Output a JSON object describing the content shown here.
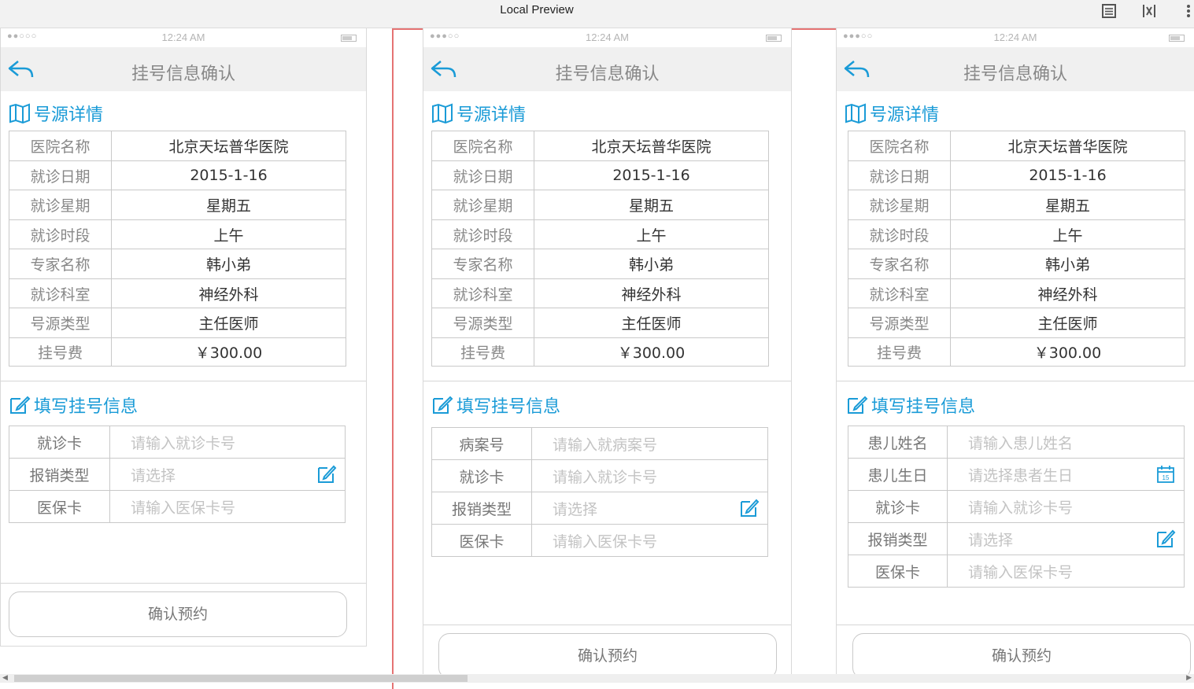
{
  "app": {
    "title": "Local Preview",
    "toolbar_icons": [
      "document-icon",
      "variable-icon",
      "more-icon"
    ]
  },
  "phone": {
    "status_time": "12:24 AM",
    "nav_title": "挂号信息确认",
    "section_detail_title": "号源详情",
    "section_form_title": "填写挂号信息",
    "confirm_label": "确认预约"
  },
  "detail_rows": [
    {
      "label": "医院名称",
      "value": "北京天坛普华医院"
    },
    {
      "label": "就诊日期",
      "value": "2015-1-16"
    },
    {
      "label": "就诊星期",
      "value": "星期五"
    },
    {
      "label": "就诊时段",
      "value": "上午"
    },
    {
      "label": "专家名称",
      "value": "韩小弟"
    },
    {
      "label": "就诊科室",
      "value": "神经外科"
    },
    {
      "label": "号源类型",
      "value": "主任医师"
    },
    {
      "label": "挂号费",
      "value": "￥300.00"
    }
  ],
  "form1": [
    {
      "label": "就诊卡",
      "placeholder": "请输入就诊卡号",
      "icon": ""
    },
    {
      "label": "报销类型",
      "placeholder": "请选择",
      "icon": "edit-icon"
    },
    {
      "label": "医保卡",
      "placeholder": "请输入医保卡号",
      "icon": ""
    }
  ],
  "form2": [
    {
      "label": "病案号",
      "placeholder": "请输入就病案号",
      "icon": ""
    },
    {
      "label": "就诊卡",
      "placeholder": "请输入就诊卡号",
      "icon": ""
    },
    {
      "label": "报销类型",
      "placeholder": "请选择",
      "icon": "edit-icon"
    },
    {
      "label": "医保卡",
      "placeholder": "请输入医保卡号",
      "icon": ""
    }
  ],
  "form3": [
    {
      "label": "患儿姓名",
      "placeholder": "请输入患儿姓名",
      "icon": ""
    },
    {
      "label": "患儿生日",
      "placeholder": "请选择患者生日",
      "icon": "calendar-icon",
      "calendar_day": "15"
    },
    {
      "label": "就诊卡",
      "placeholder": "请输入就诊卡号",
      "icon": ""
    },
    {
      "label": "报销类型",
      "placeholder": "请选择",
      "icon": "edit-icon"
    },
    {
      "label": "医保卡",
      "placeholder": "请输入医保卡号",
      "icon": ""
    }
  ],
  "colors": {
    "accent": "#1a9bd7",
    "frame_red": "#e57373",
    "nav_bg": "#f0f0f0",
    "border": "#c9c9c9"
  }
}
